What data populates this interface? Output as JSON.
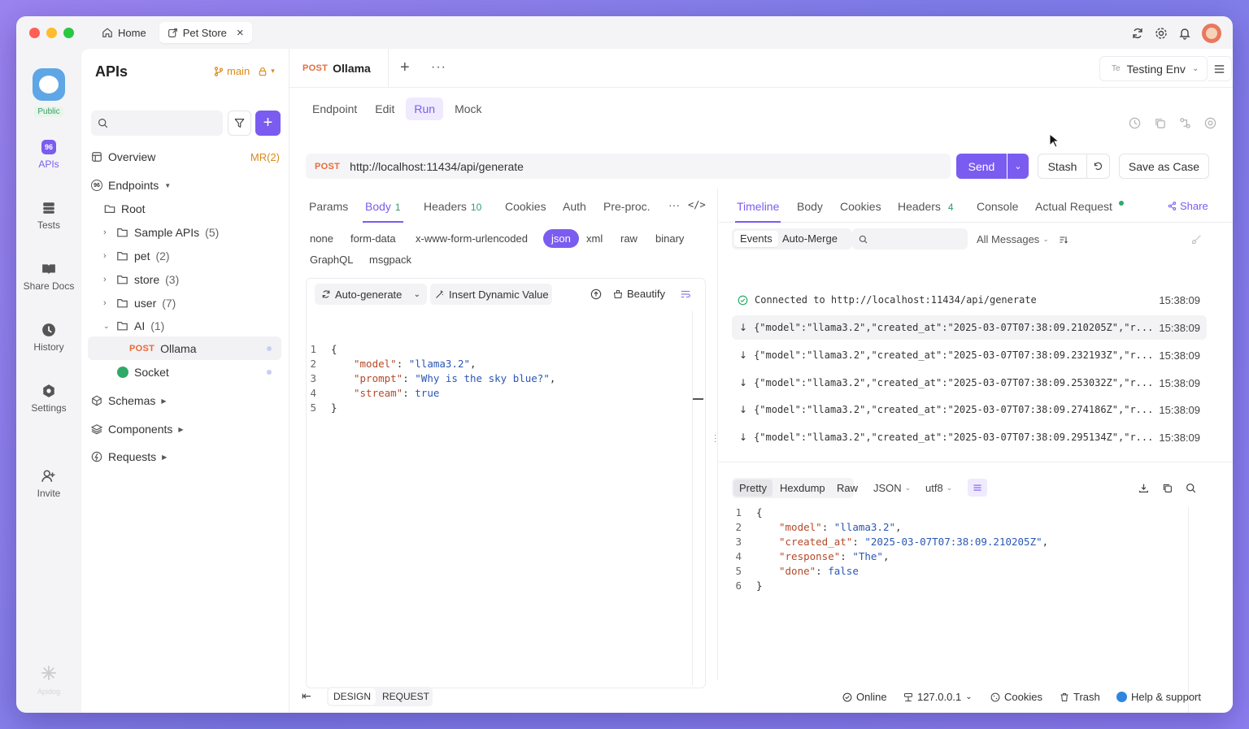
{
  "titlebar": {
    "tabs": [
      {
        "label": "Home"
      },
      {
        "label": "Pet Store"
      }
    ]
  },
  "rail": {
    "workspace_badge": "Public",
    "items": [
      {
        "label": "APIs"
      },
      {
        "label": "Tests"
      },
      {
        "label": "Share Docs"
      },
      {
        "label": "History"
      },
      {
        "label": "Settings"
      },
      {
        "label": "Invite"
      }
    ],
    "brand": "Apidog"
  },
  "sidebar": {
    "title": "APIs",
    "branch": "main",
    "search_placeholder": "",
    "overview": "Overview",
    "mr": "MR(2)",
    "endpoints": "Endpoints",
    "root": "Root",
    "folders": [
      {
        "name": "Sample APIs",
        "count": "(5)"
      },
      {
        "name": "pet",
        "count": "(2)"
      },
      {
        "name": "store",
        "count": "(3)"
      },
      {
        "name": "user",
        "count": "(7)"
      },
      {
        "name": "AI",
        "count": "(1)"
      }
    ],
    "ai_children": [
      {
        "method": "POST",
        "name": "Ollama"
      },
      {
        "name": "Socket"
      }
    ],
    "schemas": "Schemas",
    "components": "Components",
    "requests": "Requests"
  },
  "doc_tab": {
    "method": "POST",
    "name": "Ollama"
  },
  "env": {
    "prefix": "Te",
    "name": "Testing Env"
  },
  "mode_tabs": [
    "Endpoint",
    "Edit",
    "Run",
    "Mock"
  ],
  "active_mode": "Run",
  "request": {
    "method": "POST",
    "url": "http://localhost:11434/api/generate",
    "send": "Send",
    "stash": "Stash",
    "save_case": "Save as Case"
  },
  "req_tabs": [
    {
      "label": "Params",
      "badge": ""
    },
    {
      "label": "Body",
      "badge": "1"
    },
    {
      "label": "Headers",
      "badge": "10"
    },
    {
      "label": "Cookies",
      "badge": ""
    },
    {
      "label": "Auth",
      "badge": ""
    },
    {
      "label": "Pre-proc.",
      "badge": ""
    }
  ],
  "body_types": [
    "none",
    "form-data",
    "x-www-form-urlencoded",
    "json",
    "xml",
    "raw",
    "binary",
    "GraphQL",
    "msgpack"
  ],
  "active_body_type": "json",
  "editor_toolbar": {
    "auto_generate": "Auto-generate",
    "insert_dynamic": "Insert Dynamic Value",
    "beautify": "Beautify"
  },
  "body_code": {
    "line_numbers": [
      "1",
      "2",
      "3",
      "4",
      "5"
    ],
    "open": "{",
    "close": "}",
    "lines": [
      {
        "key": "\"model\"",
        "value": "\"llama3.2\"",
        "comma": ","
      },
      {
        "key": "\"prompt\"",
        "value": "\"Why is the sky blue?\"",
        "comma": ","
      },
      {
        "key": "\"stream\"",
        "value": "true",
        "comma": ""
      }
    ]
  },
  "resp_tabs": [
    {
      "label": "Timeline",
      "badge": ""
    },
    {
      "label": "Body",
      "badge": ""
    },
    {
      "label": "Cookies",
      "badge": ""
    },
    {
      "label": "Headers",
      "badge": "4"
    },
    {
      "label": "Console",
      "badge": ""
    },
    {
      "label": "Actual Request",
      "badge": ""
    }
  ],
  "share": "Share",
  "timeline": {
    "events_btn": "Events",
    "auto_merge": "Auto-Merge",
    "filter": "All Messages",
    "connected": {
      "text": "Connected to http://localhost:11434/api/generate",
      "time": "15:38:09"
    },
    "events": [
      {
        "text": "{\"model\":\"llama3.2\",\"created_at\":\"2025-03-07T07:38:09.210205Z\",\"r...",
        "time": "15:38:09"
      },
      {
        "text": "{\"model\":\"llama3.2\",\"created_at\":\"2025-03-07T07:38:09.232193Z\",\"r...",
        "time": "15:38:09"
      },
      {
        "text": "{\"model\":\"llama3.2\",\"created_at\":\"2025-03-07T07:38:09.253032Z\",\"r...",
        "time": "15:38:09"
      },
      {
        "text": "{\"model\":\"llama3.2\",\"created_at\":\"2025-03-07T07:38:09.274186Z\",\"r...",
        "time": "15:38:09"
      },
      {
        "text": "{\"model\":\"llama3.2\",\"created_at\":\"2025-03-07T07:38:09.295134Z\",\"r...",
        "time": "15:38:09"
      }
    ]
  },
  "viewer": {
    "modes": [
      "Pretty",
      "Hexdump",
      "Raw"
    ],
    "format": "JSON",
    "encoding": "utf8"
  },
  "resp_code": {
    "line_numbers": [
      "1",
      "2",
      "3",
      "4",
      "5",
      "6"
    ],
    "open": "{",
    "close": "}",
    "lines": [
      {
        "key": "\"model\"",
        "value": "\"llama3.2\"",
        "comma": ","
      },
      {
        "key": "\"created_at\"",
        "value": "\"2025-03-07T07:38:09.210205Z\"",
        "comma": ","
      },
      {
        "key": "\"response\"",
        "value": "\"The\"",
        "comma": ","
      },
      {
        "key": "\"done\"",
        "value": "false",
        "comma": ""
      }
    ]
  },
  "footer": {
    "design": "DESIGN",
    "request": "REQUEST",
    "online": "Online",
    "ip": "127.0.0.1",
    "cookies": "Cookies",
    "trash": "Trash",
    "help": "Help & support"
  },
  "colors": {
    "accent": "#7b5cf0",
    "method_post": "#e86a3a",
    "badge_green": "#2f9e6a",
    "json_key": "#b44a2a",
    "json_value": "#2a57b5"
  }
}
